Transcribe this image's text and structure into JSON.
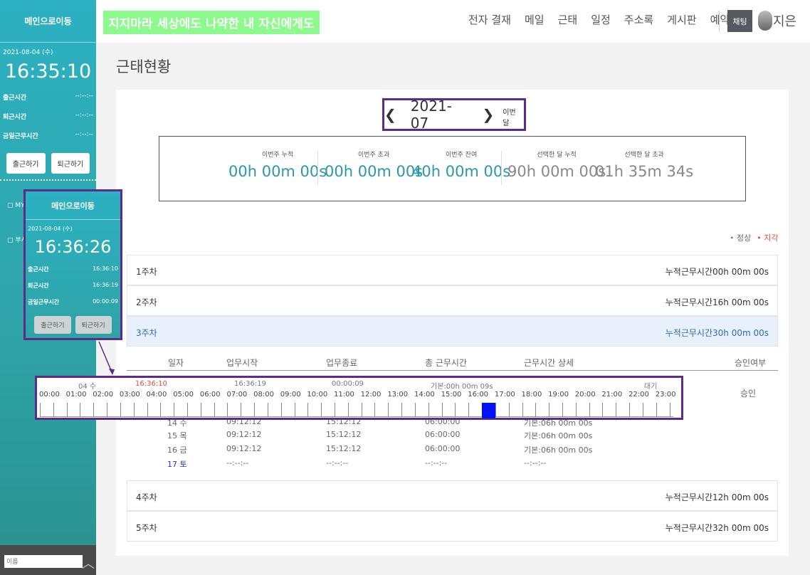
{
  "sidebar": {
    "title": "메인으로이동",
    "date": "2021-08-04 (수)",
    "clock": "16:35:10",
    "rows": [
      {
        "label": "출근시간",
        "value": "--:--:--"
      },
      {
        "label": "퇴근시간",
        "value": "--:--:--"
      },
      {
        "label": "금일근무시간",
        "value": "--:--:--"
      }
    ],
    "btn_in": "출근하기",
    "btn_out": "퇴근하기",
    "menu1": "MY",
    "menu2": "부서",
    "search_placeholder": "이름"
  },
  "topbar": {
    "slogan": "지지마라 세상에도 나약한 내 자신에게도",
    "nav": [
      "전자 결재",
      "메일",
      "근태",
      "일정",
      "주소록",
      "게시판",
      "예약"
    ],
    "chat": "채팅",
    "user": "지은"
  },
  "page": {
    "title": "근태현황",
    "month": "2021-07",
    "this_month": "이번 달"
  },
  "summary": [
    {
      "label": "이번주 누적",
      "value": "00h 00m 00s",
      "color": "#2a98a8"
    },
    {
      "label": "이번주 초과",
      "value": "00h 00m 00s",
      "color": "#2a98a8"
    },
    {
      "label": "이번주 잔여",
      "value": "40h 00m 00s",
      "color": "#2a98a8"
    },
    {
      "label": "선택한 달 누적",
      "value": "90h 00m 00s",
      "color": "#888888"
    },
    {
      "label": "선택한 달 초과",
      "value": "01h 35m 34s",
      "color": "#888888"
    }
  ],
  "legend": {
    "normal": "정상",
    "late": "지각"
  },
  "weeks": [
    {
      "label": "1주차",
      "total": "누적근무시간00h 00m 00s"
    },
    {
      "label": "2주차",
      "total": "누적근무시간16h 00m 00s"
    },
    {
      "label": "3주차",
      "total": "누적근무시간30h 00m 00s"
    },
    {
      "label": "4주차",
      "total": "누적근무시간12h 00m 00s"
    },
    {
      "label": "5주차",
      "total": "누적근무시간32h 00m 00s"
    }
  ],
  "detail": {
    "headers": [
      "일자",
      "업무시작",
      "업무종료",
      "총 근무시간",
      "근무시간 상세",
      "승인여부"
    ],
    "approval": "승인",
    "rows": [
      {
        "day": "14 수",
        "start": "09:12:12",
        "end": "15:12:12",
        "total": "06:00:00",
        "detail": "기본:06h 00m 00s"
      },
      {
        "day": "15 목",
        "start": "09:12:12",
        "end": "15:12:12",
        "total": "06:00:00",
        "detail": "기본:06h 00m 00s"
      },
      {
        "day": "16 금",
        "start": "09:12:12",
        "end": "15:12:12",
        "total": "06:00:00",
        "detail": "기본:06h 00m 00s"
      },
      {
        "day": "17 토",
        "start": "--:--:--",
        "end": "--:--:--",
        "total": "--:--:--",
        "detail": "--:--:--"
      }
    ]
  },
  "timeline": {
    "date": "04 수",
    "in_time": "16:36:10",
    "out_time": "16:36:19",
    "worked": "00:00:09",
    "basic": "기본:00h 00m 09s",
    "status": "대기",
    "hours": [
      "00:00",
      "01:00",
      "02:00",
      "03:00",
      "04:00",
      "05:00",
      "06:00",
      "07:00",
      "08:00",
      "09:00",
      "10:00",
      "11:00",
      "12:00",
      "13:00",
      "14:00",
      "15:00",
      "16:00",
      "17:00",
      "18:00",
      "19:00",
      "20:00",
      "21:00",
      "22:00",
      "23:00"
    ],
    "worked_block": {
      "start_hour": 16.5,
      "end_hour": 17.0,
      "color": "#0013f5"
    }
  },
  "mini": {
    "title": "메인으로이동",
    "date": "2021-08-04 (수)",
    "clock": "16:36:26",
    "rows": [
      {
        "label": "출근시간",
        "value": "16:36:10"
      },
      {
        "label": "퇴근시간",
        "value": "16:36:19"
      },
      {
        "label": "금일근무시간",
        "value": "00:00:09"
      }
    ],
    "btn_in": "출근하기",
    "btn_out": "퇴근하기"
  }
}
